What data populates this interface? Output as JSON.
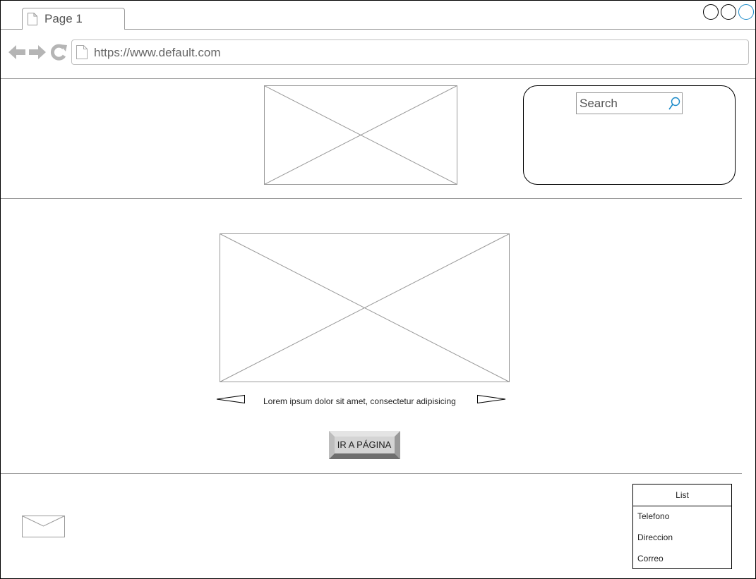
{
  "browser": {
    "tab_label": "Page 1",
    "url": "https://www.default.com",
    "accent_color": "#1a8ac9"
  },
  "header": {
    "search_placeholder": "Search"
  },
  "carousel": {
    "caption": "Lorem ipsum dolor sit amet, consectetur adipisicing",
    "button_label": "IR A PÁGINA"
  },
  "footer": {
    "list": {
      "title": "List",
      "items": [
        "Telefono",
        "Direccion",
        "Correo"
      ]
    }
  },
  "icons": {
    "tab": "page-icon",
    "back": "back-arrow-icon",
    "forward": "forward-arrow-icon",
    "reload": "reload-icon",
    "url": "page-icon",
    "search": "search-icon",
    "mail": "envelope-icon",
    "prev": "carousel-prev-icon",
    "next": "carousel-next-icon"
  }
}
